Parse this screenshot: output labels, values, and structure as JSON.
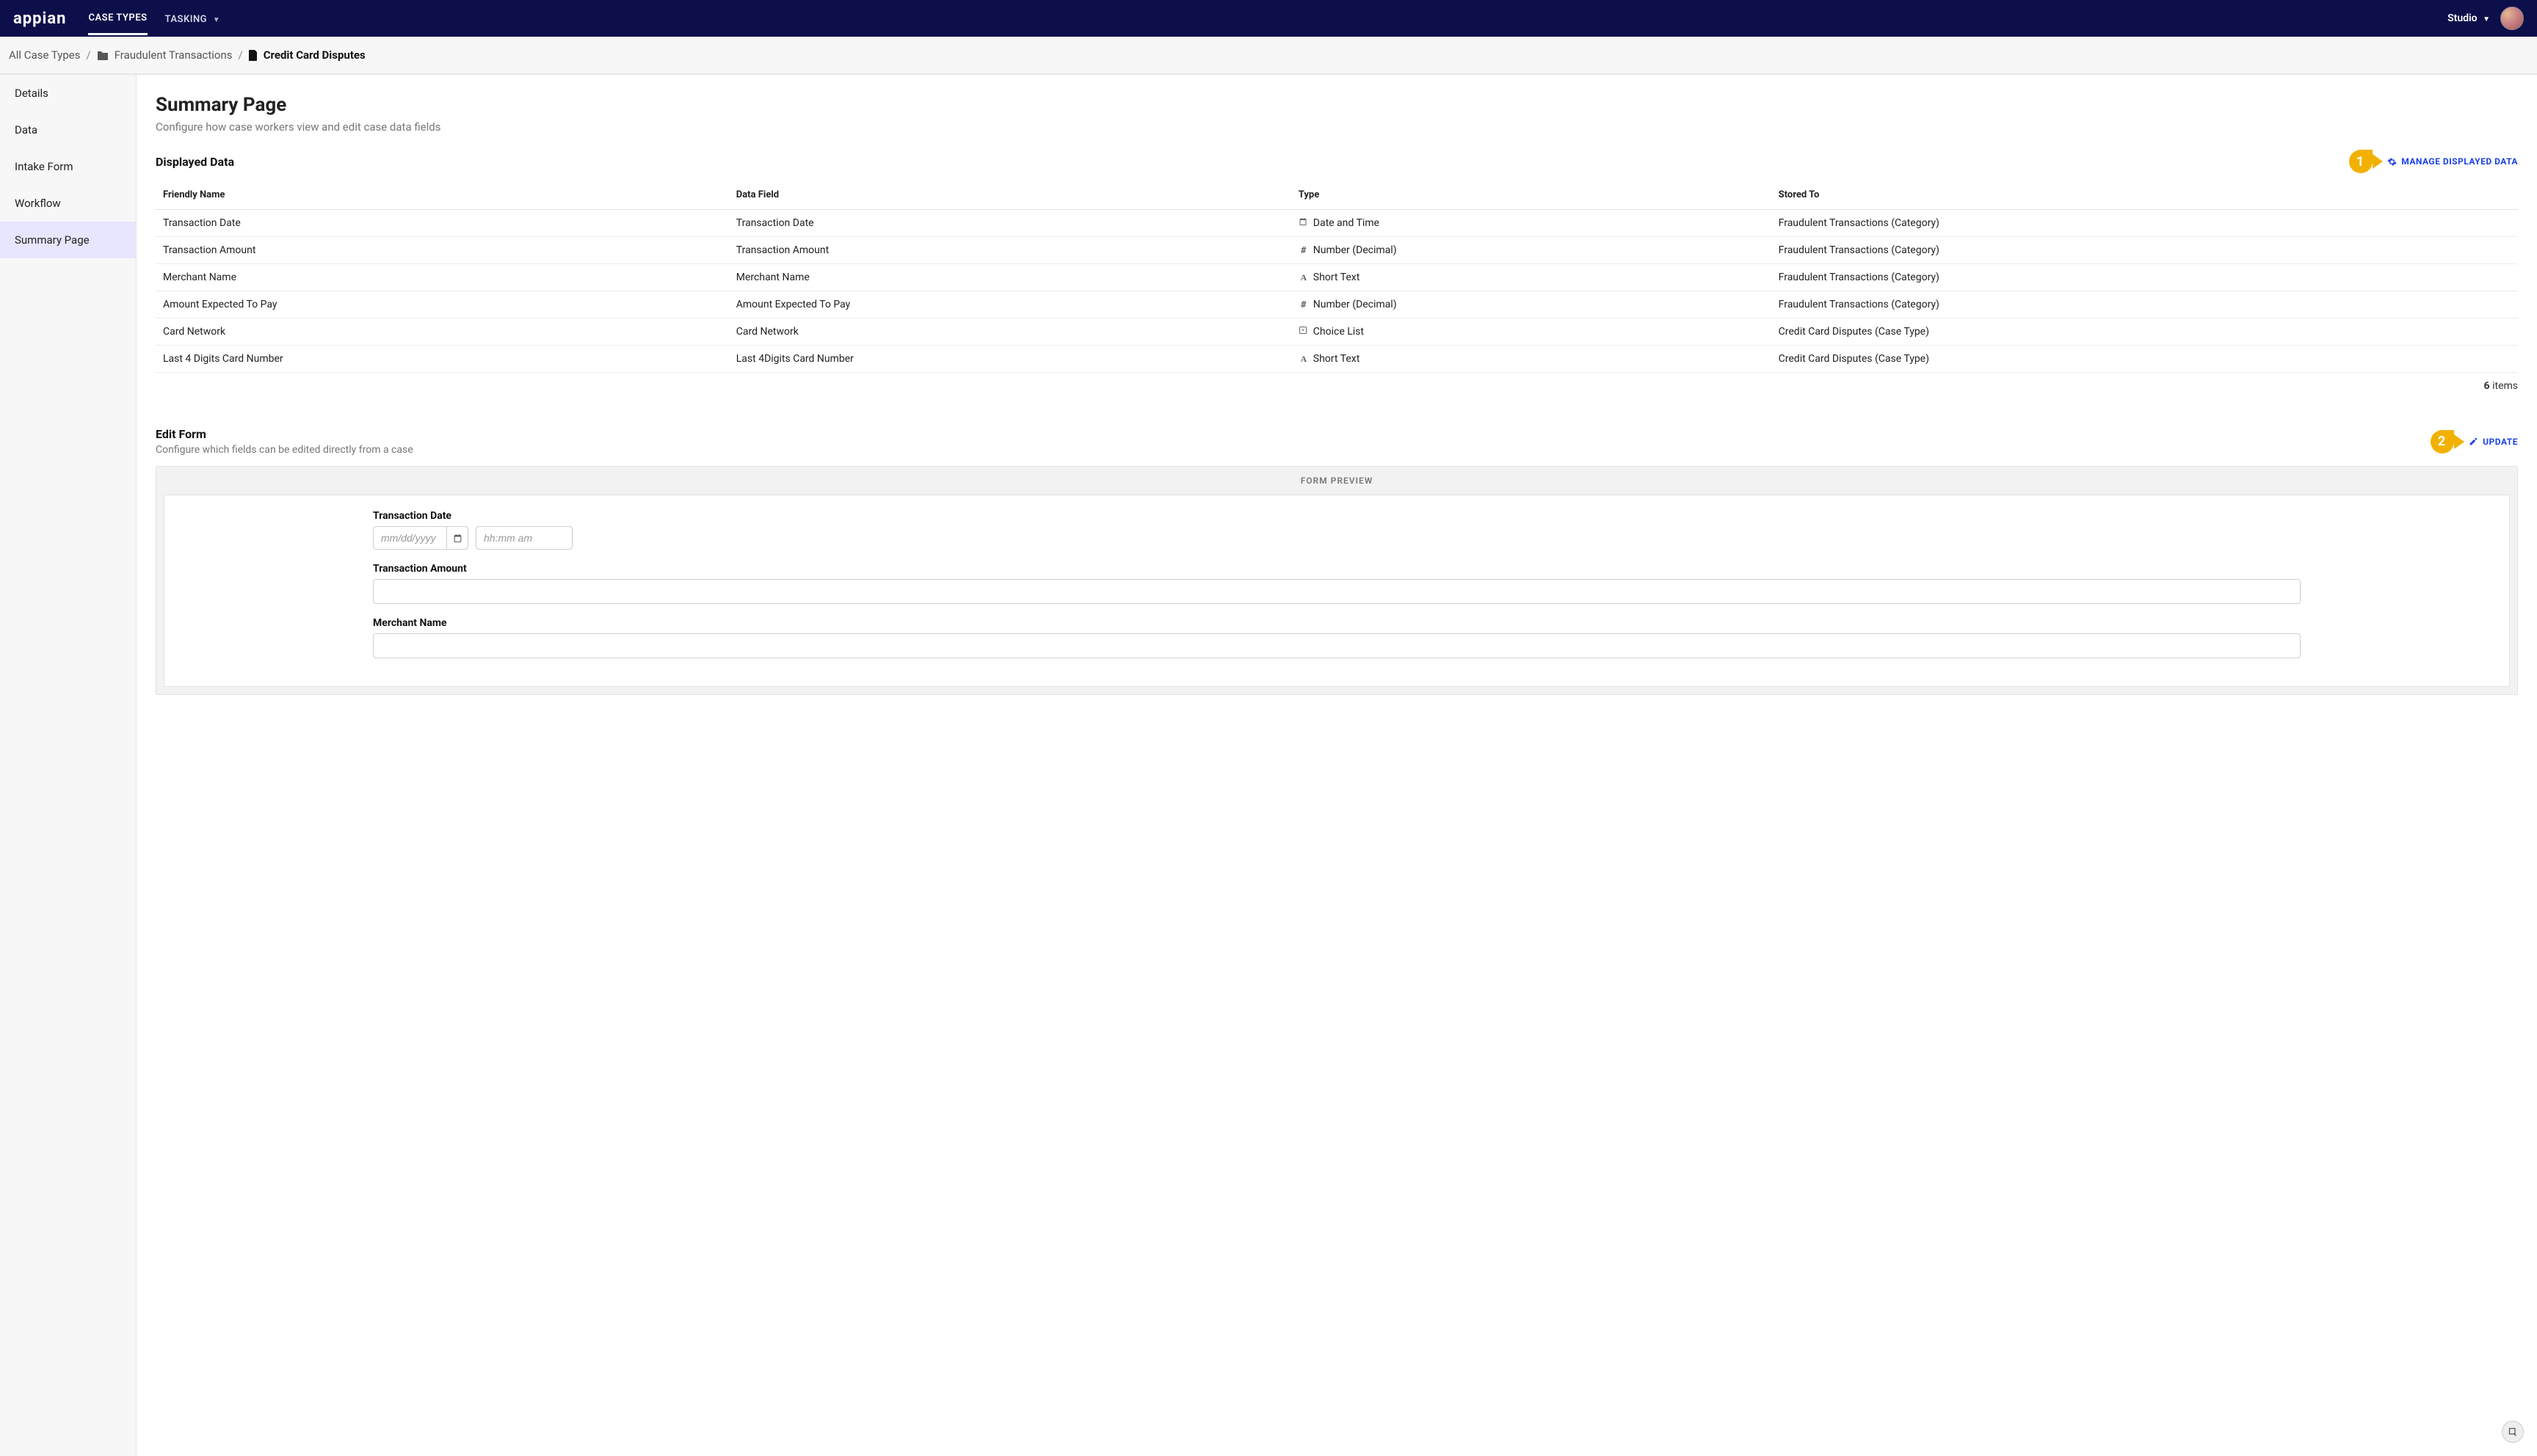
{
  "topbar": {
    "logo": "appian",
    "tabs": [
      {
        "label": "CASE TYPES",
        "active": true
      },
      {
        "label": "TASKING",
        "active": false,
        "dropdown": true
      }
    ],
    "app_switcher": "Studio"
  },
  "breadcrumb": {
    "root": "All Case Types",
    "category": "Fraudulent Transactions",
    "current": "Credit Card Disputes"
  },
  "sidebar": {
    "items": [
      {
        "label": "Details"
      },
      {
        "label": "Data"
      },
      {
        "label": "Intake Form"
      },
      {
        "label": "Workflow"
      },
      {
        "label": "Summary Page",
        "active": true
      }
    ]
  },
  "page": {
    "title": "Summary Page",
    "description": "Configure how case workers view and edit case data fields"
  },
  "callouts": {
    "one": "1",
    "two": "2"
  },
  "displayed_data": {
    "title": "Displayed Data",
    "manage_label": "MANAGE DISPLAYED DATA",
    "columns": [
      "Friendly Name",
      "Data Field",
      "Type",
      "Stored To"
    ],
    "rows": [
      {
        "friendly": "Transaction Date",
        "field": "Transaction Date",
        "type_icon": "calendar",
        "type": "Date and Time",
        "stored": "Fraudulent Transactions (Category)"
      },
      {
        "friendly": "Transaction Amount",
        "field": "Transaction Amount",
        "type_icon": "hash",
        "type": "Number (Decimal)",
        "stored": "Fraudulent Transactions (Category)"
      },
      {
        "friendly": "Merchant Name",
        "field": "Merchant Name",
        "type_icon": "text",
        "type": "Short Text",
        "stored": "Fraudulent Transactions (Category)"
      },
      {
        "friendly": "Amount Expected To Pay",
        "field": "Amount Expected To Pay",
        "type_icon": "hash",
        "type": "Number (Decimal)",
        "stored": "Fraudulent Transactions (Category)"
      },
      {
        "friendly": "Card Network",
        "field": "Card Network",
        "type_icon": "choice",
        "type": "Choice List",
        "stored": "Credit Card Disputes (Case Type)"
      },
      {
        "friendly": "Last 4 Digits Card Number",
        "field": "Last 4Digits Card Number",
        "type_icon": "text",
        "type": "Short Text",
        "stored": "Credit Card Disputes (Case Type)"
      }
    ],
    "count": "6",
    "count_label": "items"
  },
  "edit_form": {
    "title": "Edit Form",
    "description": "Configure which fields can be edited directly from a case",
    "update_label": "UPDATE",
    "preview_header": "FORM PREVIEW",
    "fields": {
      "transaction_date": {
        "label": "Transaction Date",
        "date_placeholder": "mm/dd/yyyy",
        "time_placeholder": "hh:mm am"
      },
      "transaction_amount": {
        "label": "Transaction Amount"
      },
      "merchant_name": {
        "label": "Merchant Name"
      }
    }
  }
}
